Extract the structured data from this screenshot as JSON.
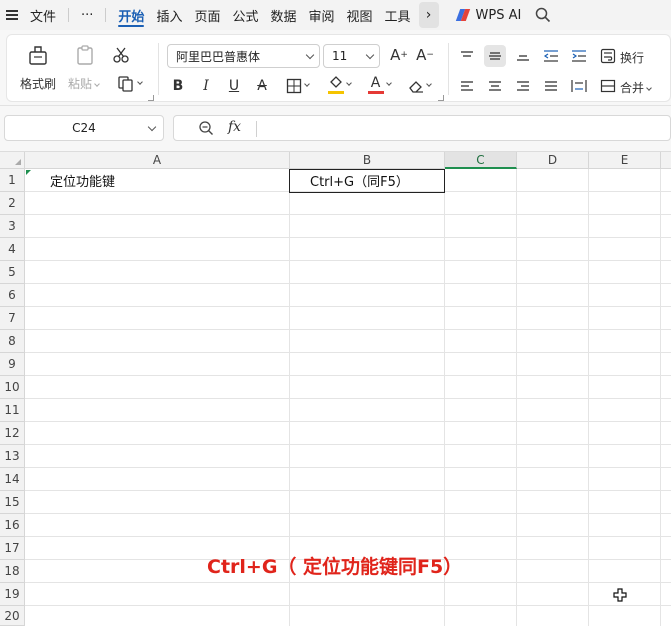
{
  "menubar": {
    "file": "文件",
    "more": "···",
    "tabs": [
      "开始",
      "插入",
      "页面",
      "公式",
      "数据",
      "审阅",
      "视图",
      "工具"
    ],
    "active_index": 0,
    "more_arrow": "›",
    "wps_ai": "WPS AI"
  },
  "ribbon": {
    "format_painter": "格式刷",
    "paste": "粘贴",
    "font_name": "阿里巴巴普惠体",
    "font_size": "11",
    "wrap": "换行",
    "merge": "合并"
  },
  "formula_bar": {
    "name_box": "C24",
    "fx": "fx",
    "formula": ""
  },
  "sheet": {
    "columns": [
      "A",
      "B",
      "C",
      "D",
      "E"
    ],
    "selected_column": "C",
    "rows": [
      "1",
      "2",
      "3",
      "4",
      "5",
      "6",
      "7",
      "8",
      "9",
      "10",
      "11",
      "12",
      "13",
      "14",
      "15",
      "16",
      "17",
      "18",
      "19",
      "20"
    ],
    "cells": {
      "A1": "定位功能键",
      "B1": "Ctrl+G（同F5）"
    }
  },
  "overlay_caption": "Ctrl+G（ 定位功能键同F5）",
  "colors": {
    "accent_blue": "#1a5fb4",
    "caption_red": "#e0241b",
    "selection_green": "#1f8f4f",
    "font_color_red": "#e53935",
    "fill_color_yellow": "#f5c400"
  }
}
